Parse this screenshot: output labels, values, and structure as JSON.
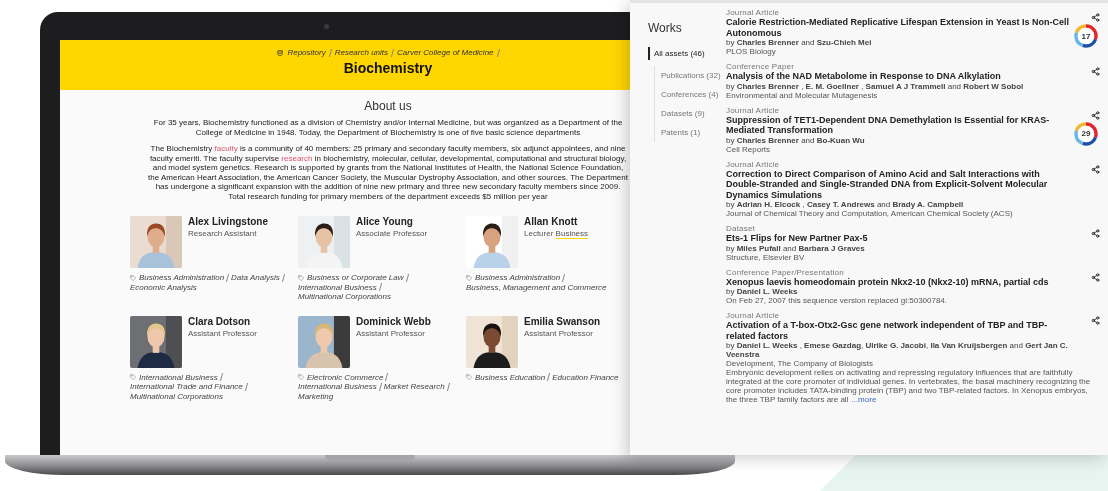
{
  "laptop_page": {
    "breadcrumb": [
      "Repository",
      "Research units",
      "Carver College of Medicine"
    ],
    "title": "Biochemistry",
    "about_heading": "About us",
    "paragraphs": [
      [
        {
          "kind": "text",
          "text": "For 35 years, Biochemistry functioned as a division of Chemistry and/or Internal Medicine, but was organized as a Department of the College of Medicine in 1948. Today, the Department of Biochemistry is one of five basic science departments"
        }
      ],
      [
        {
          "kind": "text",
          "text": "The Biochemistry "
        },
        {
          "kind": "link",
          "text": "faculty"
        },
        {
          "kind": "text",
          "text": " is a community of 40 members: 25 primary and secondary faculty members, six adjunct appointees, and nine faculty emeriti. The faculty supervise "
        },
        {
          "kind": "link",
          "text": "research"
        },
        {
          "kind": "text",
          "text": " in biochemistry, molecular, cellular, developmental, computational and structural biology, and model system genetics. Research is supported by grants from the National Institutes of Health, the National Science Foundation, the American Heart Association, the American Cancer Society, the Muscular Dystrophy Association, and other sources. The Department has undergone a significant expansion with the addition of nine new primary and three new secondary faculty members since 2009. Total research funding for primary members of the department exceeds $5 million per year"
        }
      ]
    ],
    "people": [
      {
        "name": "Alex Livingstone",
        "role": "Research Assistant",
        "tags": [
          "Business Administration",
          "Data Analysis",
          "Economic Analysis"
        ]
      },
      {
        "name": "Alice Young",
        "role": "Associate Professor",
        "tags": [
          "Business or Corporate Law",
          "International Business",
          "Multinational Corporations"
        ]
      },
      {
        "name": "Allan Knott",
        "role": "Lecturer",
        "role_link": "Business",
        "tags": [
          "Business Administration",
          "Business, Management and Commerce"
        ]
      },
      {
        "name": "Clara Dotson",
        "role": "Assistant Professor",
        "tags": [
          "International Business",
          "International Trade and Finance",
          "Multinational Corporations"
        ]
      },
      {
        "name": "Dominick Webb",
        "role": "Assistant Professor",
        "tags": [
          "Electronic Commerce",
          "International Business",
          "Market Research",
          "Marketing"
        ]
      },
      {
        "name": "Emilia Swanson",
        "role": "Assistant Professor",
        "tags": [
          "Business Education",
          "Education Finance"
        ]
      }
    ]
  },
  "works_panel": {
    "title": "Works",
    "filters": [
      {
        "label": "All assets (46)",
        "selected": true,
        "children": [
          {
            "label": "Publications (32)",
            "selected": false
          },
          {
            "label": "Conferences (4)",
            "selected": false
          },
          {
            "label": "Datasets (9)",
            "selected": false
          },
          {
            "label": "Patents (1)",
            "selected": false
          }
        ]
      }
    ],
    "items": [
      {
        "type": "Journal Article",
        "title": "Calorie Restriction-Mediated Replicative Lifespan Extension in Yeast Is Non-Cell Autonomous",
        "authors": "by **Charles Brenner** and **Szu-Chieh Mei**",
        "source": "PLOS Biology",
        "score": "17"
      },
      {
        "type": "Conference Paper",
        "title": "Analysis of the NAD Metabolome in Response to DNA Alkylation",
        "authors": "by **Charles Brenner** , **E. M. Goellner** , **Samuel A J Trammell** and **Robert W Sobol**",
        "source": "Environmental and Molecular Mutagenesis"
      },
      {
        "type": "Journal Article",
        "title": "Suppression of TET1-Dependent DNA Demethylation Is Essential for KRAS-Mediated Transformation",
        "authors": "by **Charles Brenner** and **Bo-Kuan Wu**",
        "source": "Cell Reports",
        "score": "29"
      },
      {
        "type": "Journal Article",
        "title": "Correction to Direct Comparison of Amino Acid and Salt Interactions with Double-Stranded and Single-Stranded DNA from Explicit-Solvent Molecular Dynamics Simulations",
        "authors": "by **Adrian H. Elcock** , **Casey T. Andrews** and **Brady A. Campbell**",
        "source": "Journal of Chemical Theory and Computation, American Chemical Society (ACS)"
      },
      {
        "type": "Dataset",
        "title": "Ets-1 Flips for New Partner Pax-5",
        "authors": "by **Miles Pufall** and **Barbara J Graves**",
        "source": "Structure, Elsevier BV"
      },
      {
        "type": "Conference Paper/Presentation",
        "title": "Xenopus laevis homeodomain protein Nkx2-10 (Nkx2-10) mRNA, partial cds",
        "authors": "by **Daniel L. Weeks**",
        "source": "On Feb 27, 2007 this sequence version replaced gi:50300784."
      },
      {
        "type": "Journal Article",
        "title": "Activation of a T-box-Otx2-Gsc gene network independent of TBP and TBP-related factors",
        "authors": "by **Daniel L. Weeks** , **Emese Gazdag**, **Ulrike G. Jacobi**, **Ila Van Kruijsbergen** and **Gert Jan C. Veenstra**",
        "source": "Development, The Company of Biologists",
        "abstract": "Embryonic development relies on activating and repressing regulatory influences that are faithfully integrated at the core promoter of individual genes. In vertebrates, the basal machinery recognizing the core promoter includes TATA-binding protein (TBP) and two TBP-related factors. In Xenopus embryos, the three TBP family factors are all",
        "more": "...more"
      }
    ]
  }
}
